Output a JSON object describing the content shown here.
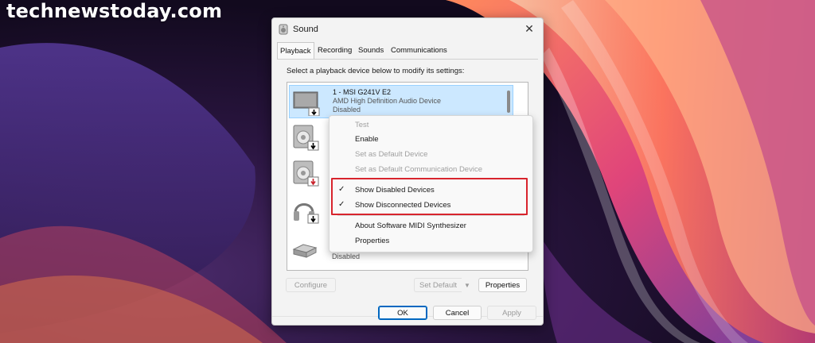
{
  "watermark": "technewstoday.com",
  "window": {
    "title": "Sound",
    "close_glyph": "✕"
  },
  "tabs": [
    {
      "label": "Playback",
      "active": true
    },
    {
      "label": "Recording",
      "active": false
    },
    {
      "label": "Sounds",
      "active": false
    },
    {
      "label": "Communications",
      "active": false
    }
  ],
  "instruction": "Select a playback device below to modify its settings:",
  "devices": [
    {
      "name": "1 - MSI G241V E2",
      "description": "AMD High Definition Audio Device",
      "status": "Disabled",
      "icon": "monitor-icon",
      "selected": true
    },
    {
      "name": "",
      "description": "",
      "status": "",
      "icon": "speaker-icon",
      "selected": false
    },
    {
      "name": "",
      "description": "",
      "status": "",
      "icon": "speaker-red-icon",
      "selected": false
    },
    {
      "name": "",
      "description": "",
      "status": "",
      "icon": "headphones-icon",
      "selected": false
    },
    {
      "name": "",
      "description": "",
      "status": "Disabled",
      "icon": "digital-output-icon",
      "selected": false
    }
  ],
  "buttons": {
    "configure": "Configure",
    "set_default": "Set Default",
    "properties": "Properties",
    "ok": "OK",
    "cancel": "Cancel",
    "apply": "Apply",
    "split_arrow": "▼"
  },
  "context_menu": {
    "items": [
      {
        "label": "Test",
        "enabled": false,
        "checked": false
      },
      {
        "label": "Enable",
        "enabled": true,
        "checked": false
      },
      {
        "label": "Set as Default Device",
        "enabled": false,
        "checked": false
      },
      {
        "label": "Set as Default Communication Device",
        "enabled": false,
        "checked": false
      },
      {
        "label": "Show Disabled Devices",
        "enabled": true,
        "checked": true
      },
      {
        "label": "Show Disconnected Devices",
        "enabled": true,
        "checked": true
      },
      {
        "label": "About Software MIDI Synthesizer",
        "enabled": true,
        "checked": false
      },
      {
        "label": "Properties",
        "enabled": true,
        "checked": false
      }
    ],
    "check_glyph": "✓"
  },
  "colors": {
    "highlight_box": "#d8242d",
    "selection": "#cce8ff",
    "accent": "#0067c0"
  }
}
